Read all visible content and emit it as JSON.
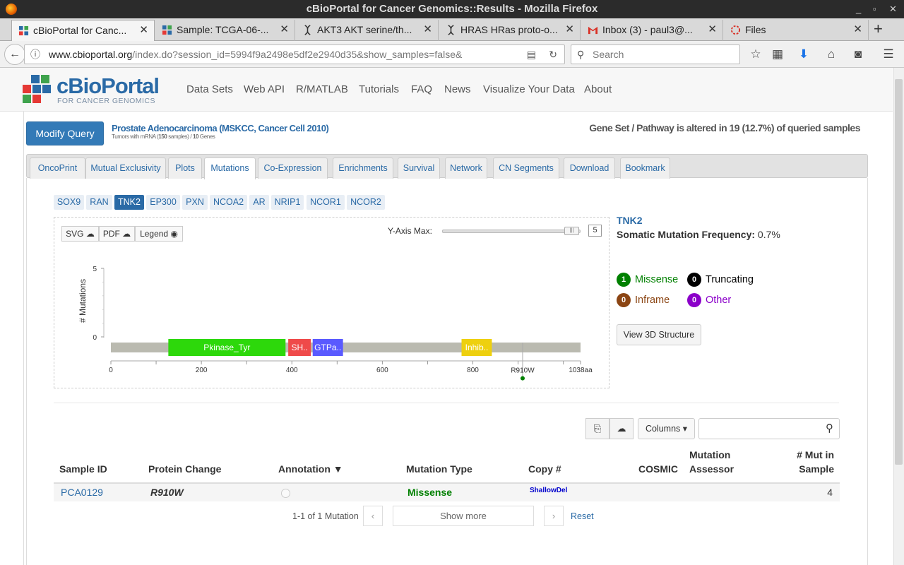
{
  "window": {
    "title": "cBioPortal for Cancer Genomics::Results - Mozilla Firefox"
  },
  "browser_tabs": [
    {
      "label": "cBioPortal for Canc...",
      "active": true
    },
    {
      "label": "Sample: TCGA-06-...",
      "active": false
    },
    {
      "label": "AKT3 AKT serine/th...",
      "active": false
    },
    {
      "label": "HRAS HRas proto-o...",
      "active": false
    },
    {
      "label": "Inbox (3) - paul3@...",
      "active": false
    },
    {
      "label": "Files",
      "active": false
    }
  ],
  "address": {
    "domain": "www.cbioportal.org",
    "path": "/index.do?session_id=5994f9a2498e5df2e2940d35&show_samples=false&"
  },
  "search": {
    "placeholder": "Search"
  },
  "site": {
    "logo_main": "cBioPortal",
    "logo_sub": "FOR CANCER GENOMICS",
    "nav": [
      "Data Sets",
      "Web API",
      "R/MATLAB",
      "Tutorials",
      "FAQ",
      "News",
      "Visualize Your Data",
      "About"
    ]
  },
  "query": {
    "modify_label": "Modify Query",
    "study_title": "Prostate Adenocarcinoma (MSKCC, Cancer Cell 2010)",
    "study_sub_a": "Tumors with mRNA (",
    "study_sub_samples": "150",
    "study_sub_b": " samples) / ",
    "study_sub_genes": "10",
    "study_sub_c": " Genes",
    "altered_text": "Gene Set / Pathway is altered in 19 (12.7%) of queried samples"
  },
  "result_tabs": [
    "OncoPrint",
    "Mutual Exclusivity",
    "Plots",
    "Mutations",
    "Co-Expression",
    "Enrichments",
    "Survival",
    "Network",
    "CN Segments",
    "Download",
    "Bookmark"
  ],
  "active_result_tab": "Mutations",
  "genes": [
    "SOX9",
    "RAN",
    "TNK2",
    "EP300",
    "PXN",
    "NCOA2",
    "AR",
    "NRIP1",
    "NCOR1",
    "NCOR2"
  ],
  "active_gene": "TNK2",
  "lollipop": {
    "svg_label": "SVG",
    "pdf_label": "PDF",
    "legend_label": "Legend",
    "yaxis_max_label": "Y-Axis Max:",
    "yaxis_max_value": "5",
    "ylabel": "# Mutations",
    "y_ticks": [
      "5",
      "0"
    ],
    "x_ticks": [
      "0",
      "200",
      "400",
      "600",
      "800",
      "1038aa"
    ],
    "protein_length": 1038,
    "domains": [
      {
        "name": "Pkinase_Tyr",
        "start": 127,
        "end": 386,
        "color": "#2dd80b"
      },
      {
        "name": "SH..",
        "start": 392,
        "end": 442,
        "color": "#ef4a4a"
      },
      {
        "name": "GTPa..",
        "start": 446,
        "end": 513,
        "color": "#5a5aff"
      },
      {
        "name": "Inhib..",
        "start": 775,
        "end": 842,
        "color": "#eed00f"
      }
    ],
    "mutation": {
      "label": "R910W",
      "position": 910,
      "count": 1,
      "color": "#008000"
    }
  },
  "summary": {
    "gene": "TNK2",
    "freq_label": "Somatic Mutation Frequency:",
    "freq_value": "0.7%",
    "legend": [
      {
        "count": "1",
        "label": "Missense",
        "color": "#008000",
        "text_color": "#008000"
      },
      {
        "count": "0",
        "label": "Truncating",
        "color": "#000000",
        "text_color": "#000000"
      },
      {
        "count": "0",
        "label": "Inframe",
        "color": "#8b4513",
        "text_color": "#8b4513"
      },
      {
        "count": "0",
        "label": "Other",
        "color": "#8b00c9",
        "text_color": "#8b00c9"
      }
    ],
    "view3d_label": "View 3D Structure"
  },
  "table": {
    "columns_label": "Columns",
    "headers": {
      "sample_id": "Sample ID",
      "protein_change": "Protein Change",
      "annotation": "Annotation ▼",
      "mutation_type": "Mutation Type",
      "copy": "Copy #",
      "cosmic": "COSMIC",
      "assessor_a": "Mutation",
      "assessor_b": "Assessor",
      "mut_a": "# Mut in",
      "mut_b": "Sample"
    },
    "rows": [
      {
        "sample_id": "PCA0129",
        "protein_change": "R910W",
        "mutation_type": "Missense",
        "copy": "ShallowDel",
        "mut_in_sample": "4"
      }
    ],
    "pagination_text": "1-1 of 1 Mutation",
    "show_more": "Show more",
    "reset": "Reset"
  }
}
